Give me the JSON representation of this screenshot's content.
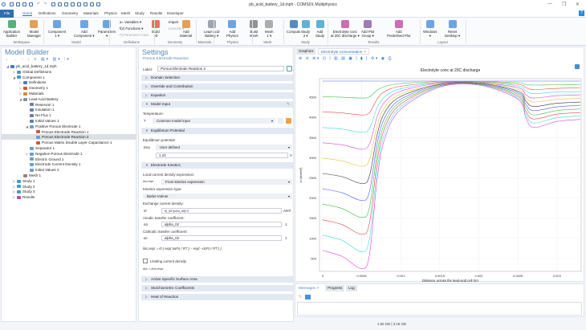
{
  "window": {
    "title": "pb_acid_battery_1d.mph - COMSOL Multiphysics",
    "minimize": "—",
    "restore": "❐",
    "close": "✕",
    "help": "?"
  },
  "menu": [
    "File",
    "Home",
    "Definitions",
    "Geometry",
    "Materials",
    "Physics",
    "Mesh",
    "Study",
    "Results",
    "Developer"
  ],
  "ribbon": {
    "buttons": [
      {
        "label": "Application\nBuilder",
        "color": "#2e9e5b"
      },
      {
        "label": "Model\nManager",
        "color": "#e08a2c"
      },
      {
        "label": "Component\n1 ▾",
        "color": "#4a90d9"
      },
      {
        "label": "Add\nComponent ▾",
        "color": "#4a90d9"
      },
      {
        "label": "Parameters\n▾",
        "color": "#4a90d9"
      },
      {
        "label": "Build\nAll",
        "color": "#d9553b"
      },
      {
        "label": "Add\nMaterial",
        "color": "#e08a2c"
      },
      {
        "label": "Lead-Acid\nBattery ▾",
        "color": "#8a8f99"
      },
      {
        "label": "Add\nPhysics",
        "color": "#4a90d9"
      },
      {
        "label": "Build\nMesh",
        "color": "#777"
      },
      {
        "label": "Mesh\n1 ▾",
        "color": "#999"
      },
      {
        "label": "Compute",
        "color": "#2e6db4"
      },
      {
        "label": "Study\n3 ▾",
        "color": "#3aa0c8"
      },
      {
        "label": "Add\nStudy",
        "color": "#3aa0c8"
      },
      {
        "label": "Electrolyte conc\nat 20C discharge ▾",
        "color": "#c04aa0"
      },
      {
        "label": "Add Plot\nGroup ▾",
        "color": "#8a5aa0"
      },
      {
        "label": "Add\nPredefined Plot",
        "color": "#c04aa0"
      },
      {
        "label": "Windows\n▾",
        "color": "#4a90d9"
      },
      {
        "label": "Reset\nDesktop ▾",
        "color": "#4a90d9"
      }
    ],
    "small": [
      "a= Variables ▾",
      "f(x) Functions ▾",
      "P| Parameter Case",
      "Import",
      "LiveLink ▾"
    ],
    "groups": [
      "Workspace",
      "Model",
      "Definitions",
      "Geometry",
      "Materials",
      "Physics",
      "Mesh",
      "Study",
      "Results",
      "Layout"
    ]
  },
  "model_builder": {
    "title": "Model Builder",
    "tree": [
      {
        "label": "pb_acid_battery_1d.mph",
        "level": 0,
        "icon": "model-icon",
        "color": "#3a7bd5",
        "arrow": "◢"
      },
      {
        "label": "Global Definitions",
        "level": 1,
        "icon": "globe-icon",
        "color": "#5a8fd0",
        "arrow": "▷"
      },
      {
        "label": "Component 1",
        "level": 1,
        "icon": "component-icon",
        "color": "#4a90d9",
        "arrow": "◢"
      },
      {
        "label": "Definitions",
        "level": 2,
        "icon": "definitions-icon",
        "color": "#4a7fc0",
        "arrow": "▷"
      },
      {
        "label": "Geometry 1",
        "level": 2,
        "icon": "geometry-icon",
        "color": "#d9553b",
        "arrow": "▷"
      },
      {
        "label": "Materials",
        "level": 2,
        "icon": "materials-icon",
        "color": "#e08a2c",
        "arrow": "▷"
      },
      {
        "label": "Lead-Acid Battery",
        "level": 2,
        "icon": "battery-icon",
        "color": "#8a8f99",
        "arrow": "◢"
      },
      {
        "label": "Reservoir 1",
        "level": 3,
        "icon": "reservoir-icon",
        "color": "#6a7fa0",
        "arrow": ""
      },
      {
        "label": "Insulation 1",
        "level": 3,
        "icon": "insulation-icon",
        "color": "#6a7fa0",
        "arrow": ""
      },
      {
        "label": "No Flux 1",
        "level": 3,
        "icon": "no-flux-icon",
        "color": "#6a7fa0",
        "arrow": ""
      },
      {
        "label": "Initial Values 1",
        "level": 3,
        "icon": "initial-values-icon",
        "color": "#6a7fa0",
        "arrow": ""
      },
      {
        "label": "Positive Porous Electrode 1",
        "level": 3,
        "icon": "electrode-icon",
        "color": "#6a9fd0",
        "arrow": "◢"
      },
      {
        "label": "Porous Electrode Reaction 1",
        "level": 4,
        "icon": "reaction-icon",
        "color": "#d9553b",
        "arrow": ""
      },
      {
        "label": "Porous Electrode Reaction 2",
        "level": 4,
        "icon": "reaction-icon",
        "color": "#6a9fd0",
        "arrow": "",
        "selected": true
      },
      {
        "label": "Porous Matrix Double Layer Capacitance 1",
        "level": 4,
        "icon": "capacitance-icon",
        "color": "#d9553b",
        "arrow": ""
      },
      {
        "label": "Separator 1",
        "level": 3,
        "icon": "separator-icon",
        "color": "#6a9fd0",
        "arrow": ""
      },
      {
        "label": "Negative Porous Electrode 1",
        "level": 3,
        "icon": "electrode-icon",
        "color": "#6a9fd0",
        "arrow": "▷"
      },
      {
        "label": "Electric Ground 1",
        "level": 3,
        "icon": "ground-icon",
        "color": "#6a9fd0",
        "arrow": ""
      },
      {
        "label": "Electrode Current Density 1",
        "level": 3,
        "icon": "current-icon",
        "color": "#6a9fd0",
        "arrow": ""
      },
      {
        "label": "Initial Values 2",
        "level": 3,
        "icon": "initial-values-icon",
        "color": "#6a9fd0",
        "arrow": ""
      },
      {
        "label": "Mesh 1",
        "level": 2,
        "icon": "mesh-icon",
        "color": "#888",
        "arrow": ""
      },
      {
        "label": "Study 1",
        "level": 1,
        "icon": "study-icon",
        "color": "#3aa0c8",
        "arrow": "▷"
      },
      {
        "label": "Study 2",
        "level": 1,
        "icon": "study-icon",
        "color": "#3aa0c8",
        "arrow": "▷"
      },
      {
        "label": "Study 3",
        "level": 1,
        "icon": "study-icon",
        "color": "#3aa0c8",
        "arrow": "▷"
      },
      {
        "label": "Results",
        "level": 1,
        "icon": "results-icon",
        "color": "#c04aa0",
        "arrow": "▷"
      }
    ]
  },
  "settings": {
    "title": "Settings",
    "subtitle": "Porous Electrode Reaction",
    "label_caption": "Label:",
    "label_value": "Porous Electrode Reaction 2",
    "sections": {
      "domain_selection": "Domain Selection",
      "override": "Override and Contribution",
      "equation": "Equation",
      "model_input": "Model Input",
      "equilibrium": "Equilibrium Potential",
      "kinetics": "Electrode Kinetics",
      "surface_area": "Active Specific Surface Area",
      "stoich": "Stoichiometric Coefficients",
      "heat": "Heat of Reaction"
    },
    "temperature_label": "Temperature:",
    "temperature_symbol": "T",
    "temperature_value": "Common model input",
    "eq_pot_label": "Equilibrium potential:",
    "eq_symbol": "Eeq",
    "eq_mode": "User defined",
    "eq_value": "1.23",
    "eq_unit": "V",
    "local_cd_label": "Local current density expression:",
    "local_cd_symbol": "iloc,expr",
    "local_cd_value": "From kinetics expression",
    "kin_type_label": "Kinetics expression type:",
    "kin_type_value": "Butler-Volmer",
    "i0_label": "Exchange current density:",
    "i0_symbol": "i0",
    "i0_value": "i0_02*(cl/cl_ref)^2",
    "i0_unit": "A/m²",
    "alpha_a_label": "Anodic transfer coefficient:",
    "alpha_a_symbol": "αa",
    "alpha_a_value": "alpha_02",
    "alpha_a_unit": "1",
    "alpha_c_label": "Cathodic transfer coefficient:",
    "alpha_c_symbol": "αc",
    "alpha_c_value": "alpha_02",
    "alpha_c_unit": "1",
    "formula": "iloc,expr = i0 ( exp( αaFη / RT ) − exp( −αcFη / RT ) )",
    "limiting_label": "Limiting current density",
    "limiting_checked": false,
    "iloc_formula": "iloc = iloc,expr"
  },
  "graphics": {
    "tabs": [
      "Graphics",
      "Electrolyte Concentration"
    ]
  },
  "messages": {
    "tabs": [
      "Messages",
      "Progress",
      "Log"
    ]
  },
  "status": {
    "memory": "1.65 GB | 3.18 GB"
  },
  "chart_data": {
    "type": "line",
    "title": "Electrolyte conc at 20C discharge",
    "xlabel": "Distance across the lead-acid cell (m)",
    "ylabel": "cl (mol/m³)",
    "xlim": [
      -4e-05,
      0.00331
    ],
    "ylim": [
      180,
      4960
    ],
    "xticks": [
      0,
      0.0005,
      0.001,
      0.0015,
      0.002,
      0.0025,
      0.003
    ],
    "xtick_labels": [
      "0",
      "0.0005",
      "0.001",
      "0.0015",
      "0.002",
      "0.0025",
      "0.003"
    ],
    "yticks": [
      500,
      1000,
      1500,
      2000,
      2500,
      3000,
      3500,
      4000,
      4500
    ],
    "grid": true,
    "colors": [
      "#4a5cff",
      "#3cbf4a",
      "#e8454a",
      "#3ad8d8",
      "#d848d8",
      "#e8c030",
      "#333333"
    ],
    "x": [
      0,
      0.00025,
      0.0005,
      0.0006,
      0.0007,
      0.0008,
      0.001,
      0.0015,
      0.002,
      0.0025,
      0.0026,
      0.0027,
      0.003,
      0.0033
    ],
    "series": [
      {
        "values": [
          4900,
          4900,
          4900,
          4900,
          4900,
          4900,
          4900,
          4900,
          4900,
          4900,
          4900,
          4900,
          4900,
          4900
        ]
      },
      {
        "values": [
          4520,
          4500,
          4480,
          4510,
          4680,
          4770,
          4840,
          4890,
          4890,
          4860,
          4820,
          4800,
          4810,
          4810
        ]
      },
      {
        "values": [
          4140,
          4110,
          4060,
          4120,
          4460,
          4650,
          4770,
          4870,
          4880,
          4820,
          4740,
          4690,
          4720,
          4730
        ]
      },
      {
        "values": [
          3750,
          3710,
          3630,
          3730,
          4250,
          4520,
          4710,
          4860,
          4870,
          4780,
          4660,
          4590,
          4630,
          4640
        ]
      },
      {
        "values": [
          3370,
          3320,
          3210,
          3340,
          4030,
          4390,
          4650,
          4850,
          4860,
          4740,
          4570,
          4480,
          4540,
          4560
        ]
      },
      {
        "values": [
          2990,
          2920,
          2790,
          2950,
          3810,
          4260,
          4580,
          4830,
          4860,
          4700,
          4490,
          4380,
          4450,
          4470
        ]
      },
      {
        "values": [
          2610,
          2530,
          2360,
          2550,
          3590,
          4140,
          4520,
          4820,
          4850,
          4650,
          4410,
          4270,
          4350,
          4380
        ]
      },
      {
        "values": [
          2230,
          2130,
          1940,
          2160,
          3370,
          4010,
          4450,
          4810,
          4840,
          4610,
          4330,
          4170,
          4260,
          4300
        ]
      },
      {
        "values": [
          1850,
          1740,
          1520,
          1770,
          3160,
          3880,
          4390,
          4790,
          4830,
          4570,
          4250,
          4060,
          4170,
          4210
        ]
      },
      {
        "values": [
          1460,
          1340,
          1100,
          1380,
          2940,
          3760,
          4330,
          4780,
          4820,
          4530,
          4160,
          3960,
          4080,
          4120
        ]
      },
      {
        "values": [
          1080,
          950,
          670,
          990,
          2720,
          3630,
          4260,
          4760,
          4810,
          4490,
          4080,
          3860,
          3990,
          4040
        ]
      },
      {
        "values": [
          700,
          550,
          250,
          600,
          2500,
          3500,
          4200,
          4750,
          4800,
          4450,
          4000,
          3750,
          3900,
          3950
        ]
      }
    ]
  }
}
